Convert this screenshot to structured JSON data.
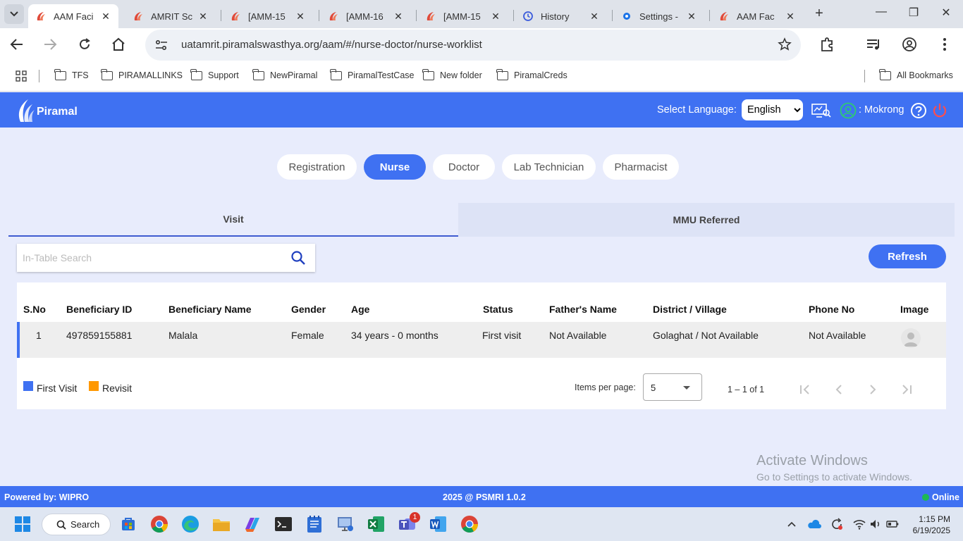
{
  "browser": {
    "tabs": [
      {
        "label": "AAM Faci",
        "active": true,
        "icon": "piramal-icon"
      },
      {
        "label": "AMRIT Sc",
        "active": false,
        "icon": "piramal-icon"
      },
      {
        "label": "[AMM-15",
        "active": false,
        "icon": "piramal-icon"
      },
      {
        "label": "[AMM-16",
        "active": false,
        "icon": "piramal-icon"
      },
      {
        "label": "[AMM-15",
        "active": false,
        "icon": "piramal-icon"
      },
      {
        "label": "History",
        "active": false,
        "icon": "history-icon"
      },
      {
        "label": "Settings -",
        "active": false,
        "icon": "gear-icon"
      },
      {
        "label": "AAM Fac",
        "active": false,
        "icon": "piramal-icon"
      }
    ],
    "url": "uatamrit.piramalswasthya.org/aam/#/nurse-doctor/nurse-worklist",
    "bookmarks": [
      "TFS",
      "PIRAMALLINKS",
      "Support",
      "NewPiramal",
      "PiramalTestCase",
      "New folder",
      "PiramalCreds"
    ],
    "all_bookmarks": "All Bookmarks"
  },
  "header": {
    "brand": "Piramal",
    "select_language_label": "Select Language:",
    "language_selected": "English",
    "user": ": Mokrong",
    "accent": "#3f71f2"
  },
  "roles": [
    "Registration",
    "Nurse",
    "Doctor",
    "Lab Technician",
    "Pharmacist"
  ],
  "active_role": "Nurse",
  "subtabs": {
    "visit": "Visit",
    "mmu": "MMU Referred"
  },
  "search": {
    "placeholder": "In-Table Search",
    "value": ""
  },
  "refresh_label": "Refresh",
  "table": {
    "headers": [
      "S.No",
      "Beneficiary ID",
      "Beneficiary Name",
      "Gender",
      "Age",
      "Status",
      "Father's Name",
      "District / Village",
      "Phone No",
      "Image"
    ],
    "rows": [
      {
        "sno": "1",
        "beneficiary_id": "497859155881",
        "name": "Malala",
        "gender": "Female",
        "age": "34 years - 0 months",
        "status": "First visit",
        "father": "Not Available",
        "district": "Golaghat / Not Available",
        "phone": "Not Available"
      }
    ]
  },
  "legend": [
    {
      "label": "First Visit",
      "color": "#3f71f2"
    },
    {
      "label": "Revisit",
      "color": "#ff9800"
    }
  ],
  "paginator": {
    "items_per_page_label": "Items per page:",
    "items_per_page": "5",
    "range": "1 – 1 of 1"
  },
  "watermark": {
    "line1": "Activate Windows",
    "line2": "Go to Settings to activate Windows."
  },
  "footer": {
    "left": "Powered by: WIPRO",
    "center": "2025 @ PSMRI 1.0.2",
    "right": "Online"
  },
  "taskbar": {
    "search": "Search",
    "time": "1:15 PM",
    "date": "6/19/2025",
    "teams_badge": "1"
  }
}
